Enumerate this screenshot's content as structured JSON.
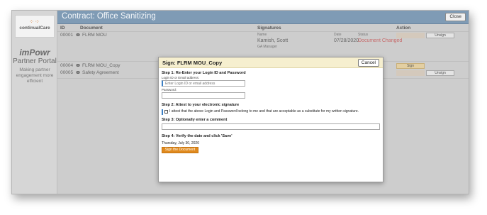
{
  "sidebar": {
    "logo_text": "continualCare",
    "brand": "imPowr",
    "portal_title": "Partner Portal",
    "portal_subtitle": "Making partner engagement more efficient"
  },
  "header": {
    "title": "Contract: Office Sanitizing",
    "close_label": "Close"
  },
  "table": {
    "columns": {
      "id": "ID",
      "document": "Document",
      "signatures": "Signatures",
      "action": "Action"
    },
    "subcolumns": {
      "name": "Name",
      "date": "Date",
      "status": "Status"
    },
    "rows": [
      {
        "id": "00001",
        "document": "FLRM MOU",
        "signer": "Kamish, Scott",
        "role": "GA Manager",
        "date": "07/28/2020",
        "status": "Document Changed",
        "action": "Unsign"
      },
      {
        "id": "00004",
        "document": "FLRM MOU_Copy",
        "action": "Sign"
      },
      {
        "id": "00005",
        "document": "Safety Agreement",
        "action": "Unsign"
      }
    ]
  },
  "modal": {
    "title": "Sign: FLRM MOU_Copy",
    "cancel_label": "Cancel",
    "step1": "Step 1: Re-Enter your Login ID and Password",
    "login_label": "Login ID or Email address:",
    "login_placeholder": "Enter Login ID or email address",
    "password_label": "Password:",
    "step2": "Step 2: Attest to your electronic signature",
    "attest_text": "I attest that the above Login and Password belong to me and that are acceptable as a substitute for my written signature.",
    "step3": "Step 3: Optionally enter a comment",
    "step4": "Step 4: Verify the date and click 'Save'",
    "date": "Thursday, July 30, 2020",
    "sign_button": "Sign the Document"
  },
  "colors": {
    "header": "#7f9bb5",
    "modal_header": "#f6efcf",
    "sign_button": "#e08a1e",
    "focus_accent": "#3b7fc4",
    "status_red": "#c76a6a"
  }
}
